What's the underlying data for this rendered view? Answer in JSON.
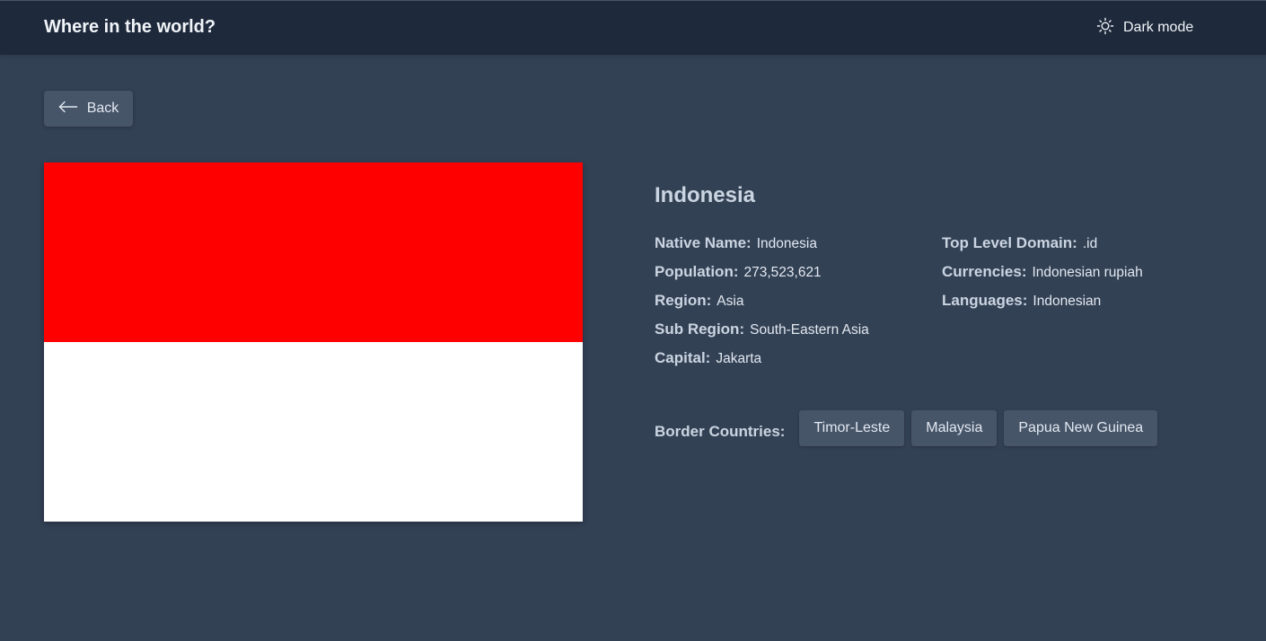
{
  "header": {
    "title": "Where in the world?",
    "mode_label": "Dark mode",
    "mode_icon": "sun-icon"
  },
  "back_button": {
    "label": "Back",
    "icon": "arrow-left-icon"
  },
  "flag": {
    "country": "Indonesia",
    "colors": {
      "top": "#ff0000",
      "bottom": "#ffffff"
    }
  },
  "country": {
    "name": "Indonesia",
    "details_left": [
      {
        "label": "Native Name:",
        "value": "Indonesia"
      },
      {
        "label": "Population:",
        "value": "273,523,621"
      },
      {
        "label": "Region:",
        "value": "Asia"
      },
      {
        "label": "Sub Region:",
        "value": "South-Eastern Asia"
      },
      {
        "label": "Capital:",
        "value": "Jakarta"
      }
    ],
    "details_right": [
      {
        "label": "Top Level Domain:",
        "value": ".id"
      },
      {
        "label": "Currencies:",
        "value": "Indonesian rupiah"
      },
      {
        "label": "Languages:",
        "value": "Indonesian"
      }
    ],
    "border_label": "Border Countries:",
    "border_countries": [
      "Timor-Leste",
      "Malaysia",
      "Papua New Guinea"
    ]
  },
  "colors": {
    "background": "#334155",
    "header": "#1e293b",
    "element": "#475569"
  }
}
